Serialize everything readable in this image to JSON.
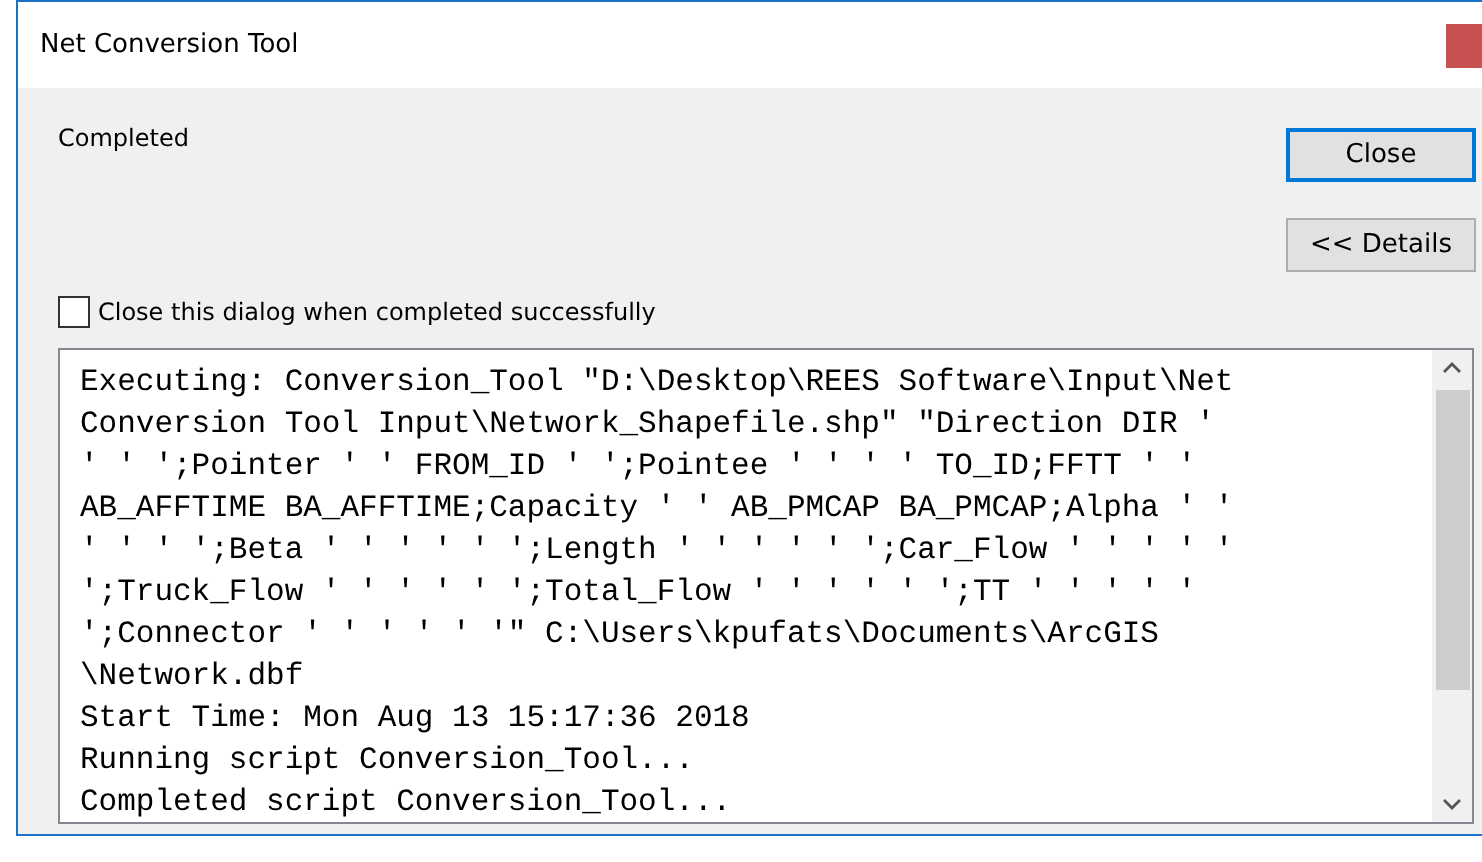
{
  "window": {
    "title": "Net Conversion Tool"
  },
  "status": "Completed",
  "buttons": [
    {
      "label": "Close",
      "focused": true
    },
    {
      "label": "<< Details",
      "focused": false
    }
  ],
  "close_when_done": {
    "label": "Close this dialog when completed successfully",
    "checked": false
  },
  "log": [
    "Executing: Conversion_Tool \"D:\\Desktop\\REES Software\\Input\\Net",
    "Conversion Tool Input\\Network_Shapefile.shp\" \"Direction DIR '",
    "' ' ';Pointer ' ' FROM_ID ' ';Pointee ' ' ' ' TO_ID;FFTT ' '",
    "AB_AFFTIME BA_AFFTIME;Capacity ' ' AB_PMCAP BA_PMCAP;Alpha ' '",
    "' ' ' ';Beta ' ' ' ' ' ';Length ' ' ' ' ' ';Car_Flow ' ' ' ' '",
    "';Truck_Flow ' ' ' ' ' ';Total_Flow ' ' ' ' ' ';TT ' ' ' ' '",
    "';Connector ' ' ' ' ' '\" C:\\Users\\kpufats\\Documents\\ArcGIS",
    "\\Network.dbf",
    "Start Time: Mon Aug 13 15:17:36 2018",
    "Running script Conversion_Tool...",
    "Completed script Conversion_Tool..."
  ]
}
